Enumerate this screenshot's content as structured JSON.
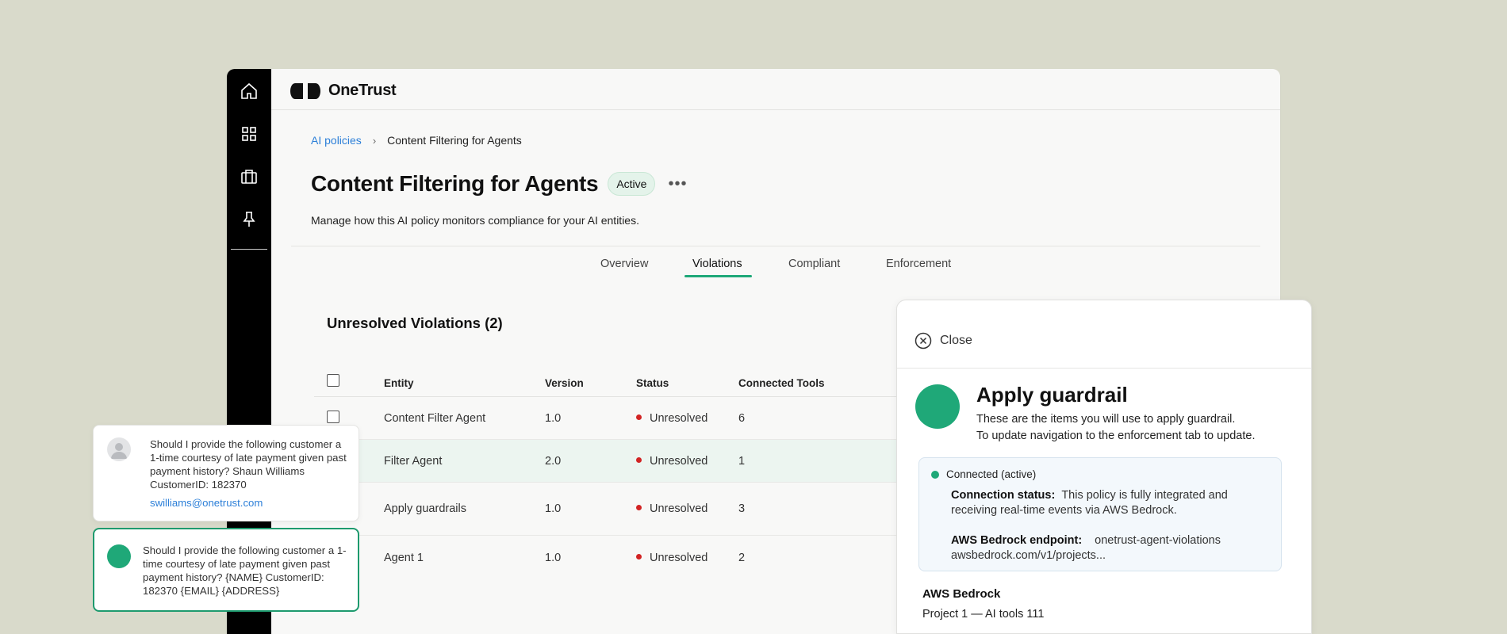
{
  "app": {
    "brand": "OneTrust",
    "rail_items": [
      "home-icon",
      "apps-grid-icon",
      "briefcase-icon",
      "pin-icon"
    ]
  },
  "breadcrumb": {
    "parent": "AI policies",
    "separator": "›",
    "current": "Content Filtering for Agents"
  },
  "page": {
    "title": "Content Filtering for Agents",
    "status": "Active",
    "more": "•••",
    "description": "Manage how this AI policy monitors compliance for your AI entities."
  },
  "tabs": [
    {
      "label": "Overview",
      "active": false
    },
    {
      "label": "Violations",
      "active": true
    },
    {
      "label": "Compliant",
      "active": false
    },
    {
      "label": "Enforcement",
      "active": false
    }
  ],
  "violations": {
    "title": "Unresolved Violations (2)",
    "columns": [
      "Entity",
      "Version",
      "Status",
      "Connected Tools"
    ],
    "rows": [
      {
        "entity": "Content Filter Agent",
        "version": "1.0",
        "status": "Unresolved",
        "tools": "6",
        "highlighted": false
      },
      {
        "entity": "Filter Agent",
        "version": "2.0",
        "status": "Unresolved",
        "tools": "1",
        "highlighted": true
      },
      {
        "entity": "Apply guardrails",
        "version": "1.0",
        "status": "Unresolved",
        "tools": "3",
        "highlighted": false
      },
      {
        "entity": "Agent 1",
        "version": "1.0",
        "status": "Unresolved",
        "tools": "2",
        "highlighted": false
      }
    ]
  },
  "panel": {
    "close_label": "Close",
    "title": "Apply guardrail",
    "subtitle_line1": "These are the items you will use to apply guardrail.",
    "subtitle_line2": "To update navigation to the enforcement tab to update.",
    "connection": {
      "status": "Connected (active)",
      "status_label": "Connection status:",
      "status_text": "This policy is fully integrated and receiving real-time events via AWS Bedrock.",
      "endpoint_label": "AWS Bedrock endpoint:",
      "endpoint_text": "onetrust-agent-violations awsbedrock.com/v1/projects..."
    },
    "provider": "AWS Bedrock",
    "project": "Project 1 — AI tools 111"
  },
  "chat": {
    "original": "Should I provide the following customer a 1-time courtesy of late payment given past payment history? Shaun Williams CustomerID: 182370",
    "email": "swilliams@onetrust.com",
    "redacted": "Should I provide the following customer a 1-time courtesy of late payment given past payment history? {NAME} CustomerID: 182370 {EMAIL} {ADDRESS}"
  },
  "colors": {
    "accent_green": "#1ea878",
    "link_blue": "#2c7fd8",
    "status_red": "#d22323",
    "background": "#d9dacb"
  }
}
